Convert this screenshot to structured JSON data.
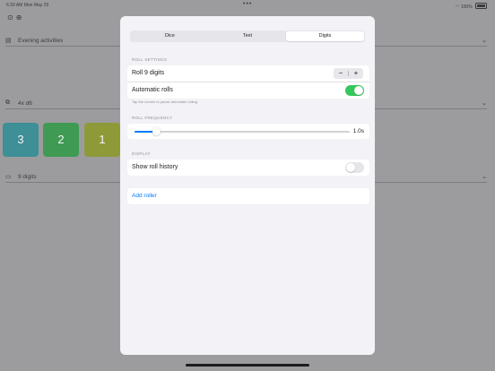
{
  "status_bar": {
    "time_date": "6:39 AM  Mon May 29",
    "dots": "•••",
    "battery": "100%"
  },
  "background": {
    "fields": [
      {
        "icon": "notes-icon",
        "text": "Evening activities"
      },
      {
        "icon": "dice-icon",
        "text": "4x d6"
      },
      {
        "icon": "digits-icon",
        "text": "9 digits"
      }
    ],
    "dice": [
      {
        "value": "3",
        "color": "#3e8f96"
      },
      {
        "value": "2",
        "color": "#3f9a53"
      },
      {
        "value": "1",
        "color": "#8e9a38"
      }
    ]
  },
  "sheet": {
    "tabs": [
      {
        "label": "Dice",
        "active": false
      },
      {
        "label": "Text",
        "active": false
      },
      {
        "label": "Digits",
        "active": true
      }
    ],
    "roll_settings": {
      "header": "ROLL SETTINGS",
      "roll_label": "Roll 9 digits",
      "stepper_minus": "−",
      "stepper_plus": "+",
      "automatic_label": "Automatic rolls",
      "automatic_on": true,
      "hint": "Tap the screen to pause automatic rolling"
    },
    "roll_frequency": {
      "header": "ROLL FREQUENCY",
      "value_label": "1.0s",
      "slider_fraction": 0.1
    },
    "display": {
      "header": "DISPLAY",
      "history_label": "Show roll history",
      "history_on": false
    },
    "add_roller": "Add roller"
  },
  "colors": {
    "accent": "#007aff",
    "toggle_on": "#34c759"
  }
}
